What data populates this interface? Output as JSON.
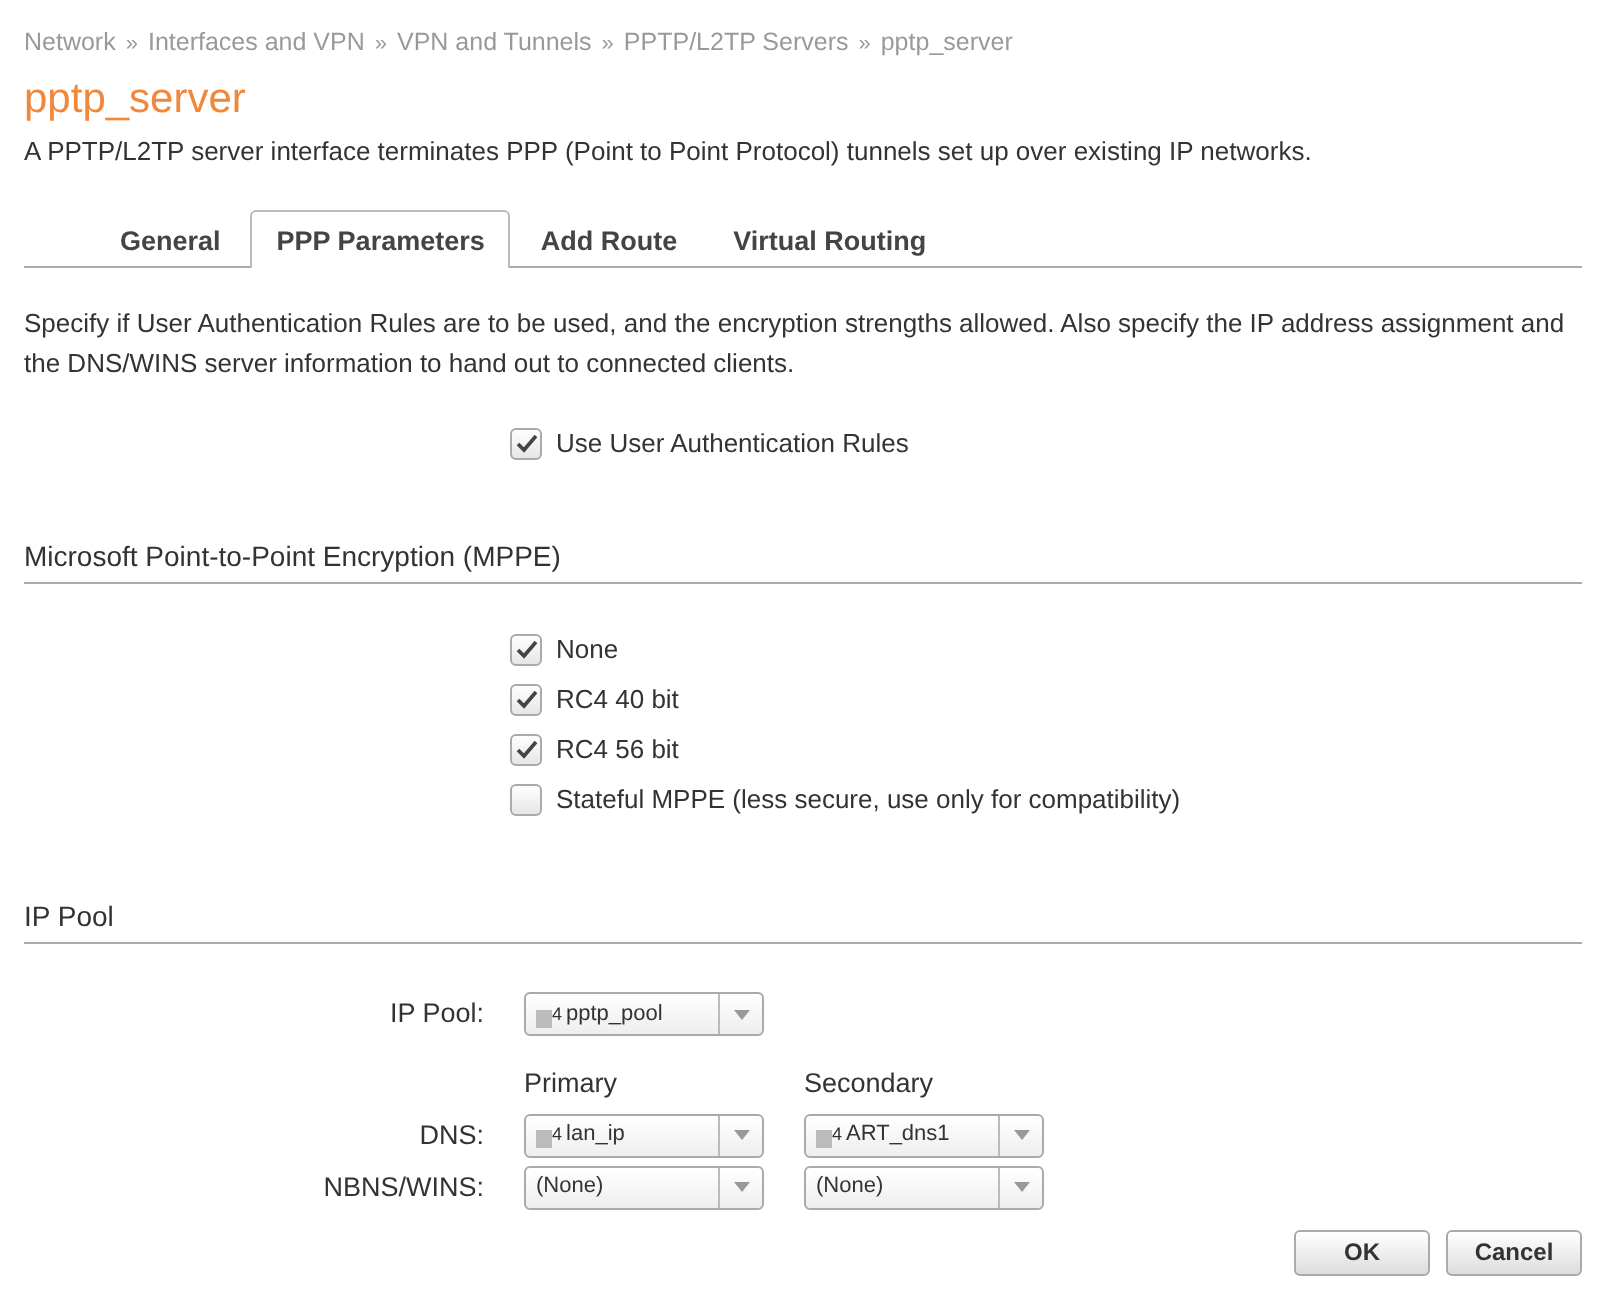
{
  "breadcrumb": [
    "Network",
    "Interfaces and VPN",
    "VPN and Tunnels",
    "PPTP/L2TP Servers",
    "pptp_server"
  ],
  "breadcrumb_separator": "»",
  "title": "pptp_server",
  "description": "A PPTP/L2TP server interface terminates PPP (Point to Point Protocol) tunnels set up over existing IP networks.",
  "tabs": [
    {
      "label": "General",
      "selected": false
    },
    {
      "label": "PPP Parameters",
      "selected": true
    },
    {
      "label": "Add Route",
      "selected": false
    },
    {
      "label": "Virtual Routing",
      "selected": false
    }
  ],
  "intro": "Specify if User Authentication Rules are to be used, and the encryption strengths allowed. Also specify the IP address assignment and the DNS/WINS server information to hand out to connected clients.",
  "auth_checkbox": {
    "label": "Use User Authentication Rules",
    "checked": true
  },
  "mppe": {
    "heading": "Microsoft Point-to-Point Encryption (MPPE)",
    "options": [
      {
        "label": "None",
        "checked": true
      },
      {
        "label": "RC4 40 bit",
        "checked": true
      },
      {
        "label": "RC4 56 bit",
        "checked": true
      },
      {
        "label": "Stateful MPPE (less secure, use only for compatibility)",
        "checked": false
      }
    ]
  },
  "ip_pool": {
    "heading": "IP Pool",
    "pool": {
      "label": "IP Pool:",
      "value": "pptp_pool",
      "icon_badge": "4"
    },
    "column_headers": [
      "Primary",
      "Secondary"
    ],
    "rows": [
      {
        "label": "DNS:",
        "values": [
          {
            "value": "lan_ip",
            "icon_badge": "4"
          },
          {
            "value": "ART_dns1",
            "icon_badge": "4"
          }
        ]
      },
      {
        "label": "NBNS/WINS:",
        "values": [
          {
            "value": "(None)"
          },
          {
            "value": "(None)"
          }
        ]
      }
    ]
  },
  "buttons": [
    "OK",
    "Cancel"
  ]
}
